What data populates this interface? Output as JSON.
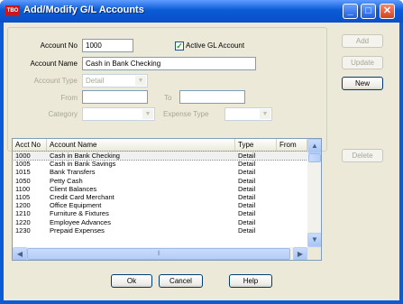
{
  "window": {
    "app_icon_text": "TBO",
    "title": "Add/Modify G/L Accounts",
    "minimize_glyph": "_",
    "maximize_glyph": "□",
    "close_glyph": "✕"
  },
  "form": {
    "account_no_label": "Account No",
    "account_no_value": "1000",
    "active_gl_label": "Active GL Account",
    "active_gl_checked": true,
    "account_name_label": "Account Name",
    "account_name_value": "Cash in Bank Checking",
    "account_type_label": "Account Type",
    "account_type_value": "Detail",
    "from_label": "From",
    "from_value": "",
    "to_label": "To",
    "to_value": "",
    "category_label": "Category",
    "category_value": "",
    "expense_type_label": "Expense Type",
    "expense_type_value": ""
  },
  "side_buttons": {
    "add": "Add",
    "update": "Update",
    "new": "New",
    "delete": "Delete"
  },
  "list": {
    "columns": [
      "Acct No",
      "Account Name",
      "Type",
      "From"
    ],
    "rows": [
      [
        "1000",
        "Cash in Bank Checking",
        "Detail",
        ""
      ],
      [
        "1005",
        "Cash in Bank Savings",
        "Detail",
        ""
      ],
      [
        "1015",
        "Bank Transfers",
        "Detail",
        ""
      ],
      [
        "1050",
        "Petty Cash",
        "Detail",
        ""
      ],
      [
        "1100",
        "Client Balances",
        "Detail",
        ""
      ],
      [
        "1105",
        "Credit Card Merchant",
        "Detail",
        ""
      ],
      [
        "1200",
        "Office Equipment",
        "Detail",
        ""
      ],
      [
        "1210",
        "Furniture & Fixtures",
        "Detail",
        ""
      ],
      [
        "1220",
        "Employee Advances",
        "Detail",
        ""
      ],
      [
        "1230",
        "Prepaid Expenses",
        "Detail",
        ""
      ]
    ],
    "selected_index": 0
  },
  "bottom_buttons": {
    "ok": "Ok",
    "cancel": "Cancel",
    "help": "Help"
  }
}
